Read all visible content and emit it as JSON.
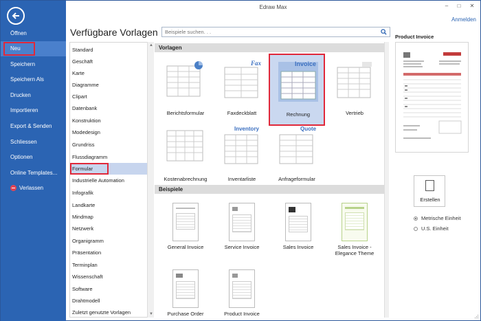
{
  "window": {
    "title": "Edraw Max",
    "signin": "Anmelden",
    "minimize_glyph": "–",
    "maximize_glyph": "□",
    "close_glyph": "✕"
  },
  "sidebar": {
    "back_icon": "back-arrow-icon",
    "items": [
      {
        "label": "Öffnen"
      },
      {
        "label": "Neu",
        "active": true
      },
      {
        "label": "Speichern"
      },
      {
        "label": "Speichern Als"
      },
      {
        "label": "Drucken"
      },
      {
        "label": "Importieren"
      },
      {
        "label": "Export & Senden"
      },
      {
        "label": "Schliessen"
      },
      {
        "label": "Optionen"
      },
      {
        "label": "Online Templates..."
      },
      {
        "label": "Verlassen",
        "icon": "exit-icon"
      }
    ]
  },
  "main": {
    "heading": "Verfügbare Vorlagen",
    "search_placeholder": "Beispiele suchen. . .",
    "categories": [
      "Standard",
      "Geschäft",
      "Karte",
      "Diagramme",
      "Clipart",
      "Datenbank",
      "Konstruktion",
      "Modedesign",
      "Grundriss",
      "Flussdiagramm",
      "Formular",
      "Industrielle Automation",
      "Infografik",
      "Landkarte",
      "Mindmap",
      "Netzwerk",
      "Organigramm",
      "Präsentation",
      "Terminplan",
      "Wissenschaft",
      "Software",
      "Drahtmodell",
      "Zuletzt genutzte Vorlagen"
    ],
    "selected_category": "Formular",
    "templates_header": "Vorlagen",
    "templates": [
      {
        "label": "Berichtsformular",
        "thumb_text": ""
      },
      {
        "label": "Faxdeckblatt",
        "thumb_text": "Fax"
      },
      {
        "label": "Rechnung",
        "thumb_text": "Invoice",
        "selected": true
      },
      {
        "label": "Vertrieb",
        "thumb_text": ""
      },
      {
        "label": "Kostenabrechnung",
        "thumb_text": ""
      },
      {
        "label": "Inventarliste",
        "thumb_text": "Inventory"
      },
      {
        "label": "Anfrageformular",
        "thumb_text": "Quote"
      }
    ],
    "examples_header": "Beispiele",
    "examples": [
      {
        "label": "General Invoice"
      },
      {
        "label": "Service Invoice"
      },
      {
        "label": "Sales Invoice"
      },
      {
        "label": "Sales Invoice - Elegance Theme"
      },
      {
        "label": "Purchase Order"
      },
      {
        "label": "Product Invoice"
      }
    ]
  },
  "preview": {
    "title": "Product Invoice",
    "create_label": "Erstellen",
    "units": [
      {
        "label": "Metrische Einheit",
        "checked": true
      },
      {
        "label": "U.S. Einheit",
        "checked": false
      }
    ]
  },
  "colors": {
    "sidebar": "#2b64b3",
    "accent": "#2b64b3",
    "highlight": "#e0283a"
  }
}
